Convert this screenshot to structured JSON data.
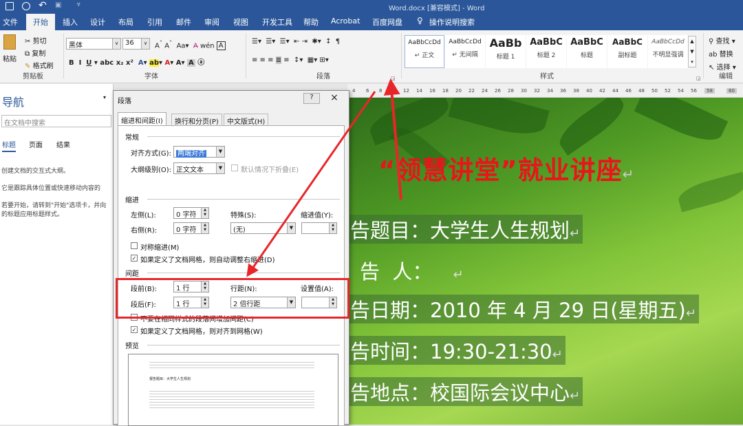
{
  "titlebar": {
    "title": "Word.docx [兼容模式] - Word"
  },
  "tabs": [
    "文件",
    "开始",
    "插入",
    "设计",
    "布局",
    "引用",
    "邮件",
    "审阅",
    "视图",
    "开发工具",
    "帮助",
    "Acrobat",
    "百度网盘",
    "操作说明搜索"
  ],
  "clipboard": {
    "paste": "粘贴",
    "cut": "剪切",
    "copy": "复制",
    "format_painter": "格式刷",
    "group": "剪贴板"
  },
  "font": {
    "name": "黑体",
    "size": "36",
    "group": "字体"
  },
  "paragraph_group": "段落",
  "styles": {
    "group": "样式",
    "items": [
      {
        "preview": "AaBbCcDd",
        "name": "↵ 正文"
      },
      {
        "preview": "AaBbCcDd",
        "name": "↵ 无间隔"
      },
      {
        "preview": "AaBb",
        "name": "标题 1"
      },
      {
        "preview": "AaBbC",
        "name": "标题 2"
      },
      {
        "preview": "AaBbC",
        "name": "标题"
      },
      {
        "preview": "AaBbC",
        "name": "副标题"
      },
      {
        "preview": "AaBbCcDd",
        "name": "不明显强调"
      }
    ]
  },
  "editing": {
    "find": "查找",
    "replace": "替换",
    "select": "选择",
    "group": "编辑"
  },
  "nav": {
    "title": "导航",
    "search_placeholder": "在文档中搜索",
    "tabs": [
      "标题",
      "页面",
      "结果"
    ],
    "line1": "创建文档的交互式大纲。",
    "line2": "它是跟踪具体位置或快速移动内容的",
    "line3": "若要开始，请转到\"开始\"选项卡，并向",
    "line4": "的标题应用标题样式。"
  },
  "ruler": [
    "4",
    "6",
    "8",
    "10",
    "12",
    "14",
    "16",
    "18",
    "20",
    "22",
    "24",
    "26",
    "28",
    "30",
    "32",
    "34",
    "36",
    "38",
    "40",
    "42",
    "44",
    "46",
    "48",
    "50",
    "52",
    "54",
    "56",
    "58",
    "60"
  ],
  "document": {
    "heading": "“领慧讲堂”就业讲座",
    "lines": [
      "告题目：大学生人生规划",
      "告  人：",
      "告日期：2010 年 4 月 29 日(星期五)",
      "告时间：19:30-21:30",
      "告地点：校国际会议中心"
    ]
  },
  "dialog": {
    "title": "段落",
    "help": "?",
    "close": "×",
    "tabs": [
      "缩进和间距(I)",
      "换行和分页(P)",
      "中文版式(H)"
    ],
    "general": "常规",
    "align_label": "对齐方式(G):",
    "align_value": "两端对齐",
    "outline_label": "大纲级别(O):",
    "outline_value": "正文文本",
    "collapse_label": "默认情况下折叠(E)",
    "indent": "缩进",
    "left_label": "左侧(L):",
    "left_value": "0 字符",
    "right_label": "右侧(R):",
    "right_value": "0 字符",
    "special_label": "特殊(S):",
    "special_value": "(无)",
    "indent_value_label": "缩进值(Y):",
    "mirror_label": "对称缩进(M)",
    "auto_adjust_label": "如果定义了文档网格，则自动调整右缩进(D)",
    "spacing": "间距",
    "before_label": "段前(B):",
    "before_value": "1 行",
    "after_label": "段后(F):",
    "after_value": "1 行",
    "line_spacing_label": "行距(N):",
    "line_spacing_value": "2 倍行距",
    "at_label": "设置值(A):",
    "no_space_label": "不要在相同样式的段落间增加间距(C)",
    "snap_grid_label": "如果定义了文档网格，则对齐到网格(W)",
    "preview": "预览",
    "preview_text": "报告题目：大学生人生规划"
  },
  "colors": {
    "accent": "#2b579a",
    "annotation": "#e8262a",
    "heading": "#e8151b"
  }
}
